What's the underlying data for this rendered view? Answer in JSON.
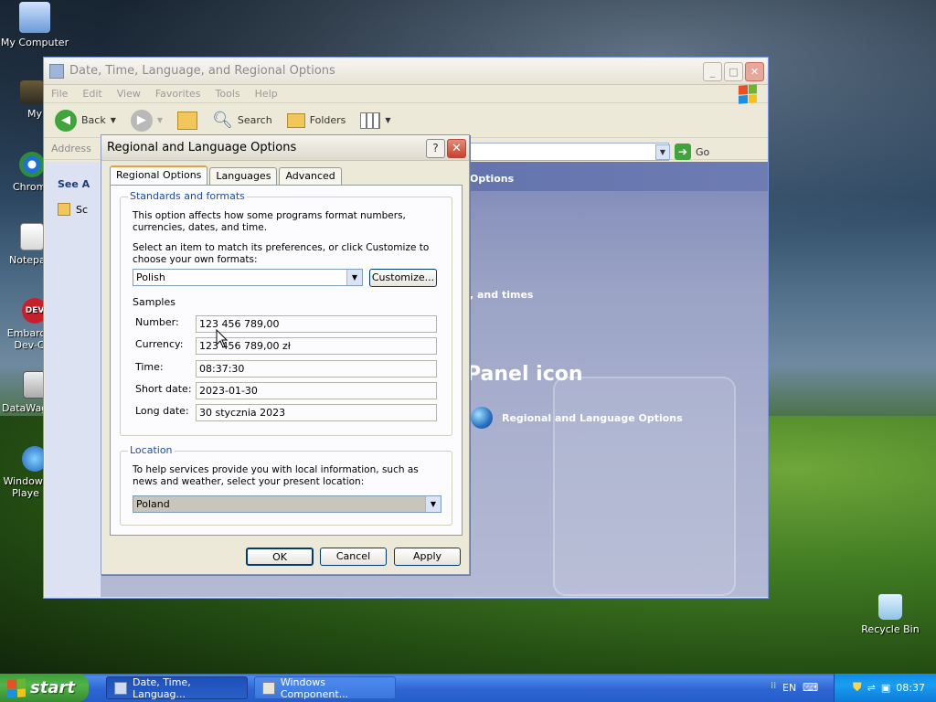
{
  "desktop": {
    "icons": [
      {
        "label": "My Computer"
      },
      {
        "label": "MyPal"
      },
      {
        "label": "Chrom"
      },
      {
        "label": "Notepa"
      },
      {
        "label": "Embarca Dev-C"
      },
      {
        "label": "DataWag"
      },
      {
        "label": "Windows Playe"
      },
      {
        "label": "Recycle Bin"
      }
    ]
  },
  "explorer": {
    "title": "Date, Time, Language, and Regional Options",
    "menu": [
      "File",
      "Edit",
      "View",
      "Favorites",
      "Tools",
      "Help"
    ],
    "toolbar": {
      "back": "Back",
      "search": "Search",
      "folders": "Folders"
    },
    "address_label": "Address",
    "go_label": "Go",
    "left_pane": {
      "see_also": "See A",
      "item": "Sc"
    },
    "content": {
      "header_suffix": "Options",
      "task_suffix": ", and times",
      "control_panel_icon": "Panel icon",
      "regional_link": "Regional and Language Options"
    }
  },
  "dialog": {
    "title": "Regional and Language Options",
    "help_glyph": "?",
    "tabs": [
      "Regional Options",
      "Languages",
      "Advanced"
    ],
    "standards": {
      "group_title": "Standards and formats",
      "desc": "This option affects how some programs format numbers, currencies, dates, and time.",
      "select_prompt": "Select an item to match its preferences, or click Customize to choose your own formats:",
      "selected_format": "Polish",
      "customize_label": "Customize...",
      "samples_label": "Samples",
      "samples": [
        {
          "label": "Number:",
          "value": "123 456 789,00"
        },
        {
          "label": "Currency:",
          "value": "123 456 789,00 zł"
        },
        {
          "label": "Time:",
          "value": "08:37:30"
        },
        {
          "label": "Short date:",
          "value": "2023-01-30"
        },
        {
          "label": "Long date:",
          "value": "30 stycznia 2023"
        }
      ]
    },
    "location": {
      "group_title": "Location",
      "desc": "To help services provide you with local information, such as news and weather, select your present location:",
      "value": "Poland"
    },
    "buttons": {
      "ok": "OK",
      "cancel": "Cancel",
      "apply": "Apply"
    }
  },
  "taskbar": {
    "start_label": "start",
    "items": [
      {
        "label": "Date, Time, Languag..."
      },
      {
        "label": "Windows Component..."
      }
    ],
    "language": "EN",
    "clock": "08:37"
  }
}
